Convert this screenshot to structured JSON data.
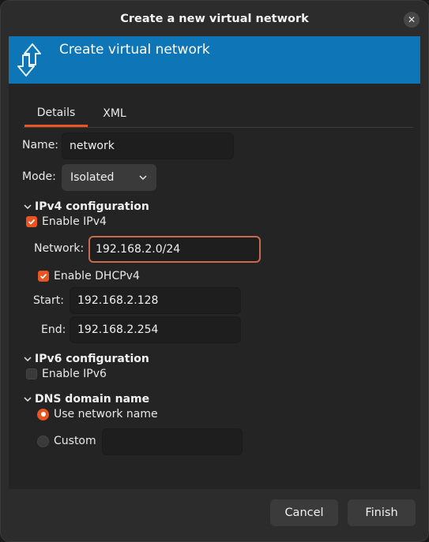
{
  "window": {
    "title": "Create a new virtual network",
    "close_glyph": "✕"
  },
  "banner": {
    "title": "Create virtual network",
    "icon": "network-arrows-icon"
  },
  "tabs": [
    {
      "label": "Details",
      "active": true
    },
    {
      "label": "XML",
      "active": false
    }
  ],
  "form": {
    "name": {
      "label": "Name:",
      "value": "network"
    },
    "mode": {
      "label": "Mode:",
      "selected": "Isolated"
    },
    "ipv4": {
      "header": "IPv4 configuration",
      "enable_label": "Enable IPv4",
      "enabled": true,
      "network": {
        "label": "Network:",
        "value": "192.168.2.0/24"
      },
      "dhcp": {
        "enable_label": "Enable DHCPv4",
        "enabled": true,
        "start": {
          "label": "Start:",
          "value": "192.168.2.128"
        },
        "end": {
          "label": "End:",
          "value": "192.168.2.254"
        }
      }
    },
    "ipv6": {
      "header": "IPv6 configuration",
      "enable_label": "Enable IPv6",
      "enabled": false
    },
    "dns": {
      "header": "DNS domain name",
      "use_network_name_label": "Use network name",
      "custom_label": "Custom",
      "selected": "use_network_name",
      "custom_value": ""
    }
  },
  "buttons": {
    "cancel": "Cancel",
    "finish": "Finish"
  },
  "colors": {
    "accent": "#E95420",
    "banner": "#0E75B6"
  }
}
